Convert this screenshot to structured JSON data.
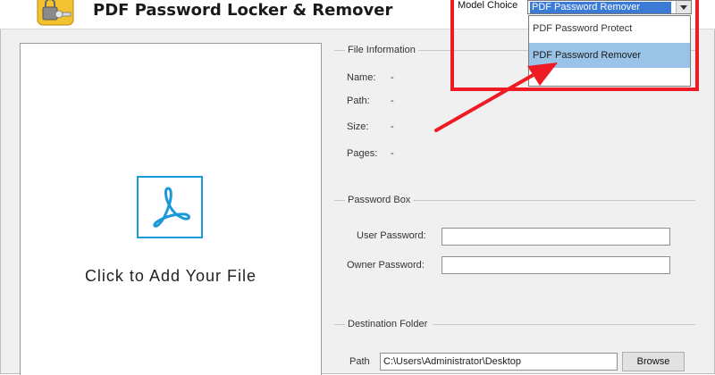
{
  "app": {
    "title": "PDF Password Locker & Remover",
    "logo": "lock-key-app-icon"
  },
  "model_choice": {
    "label": "Model Choice",
    "selected": "PDF Password Remover",
    "options": [
      "PDF Password Protect",
      "PDF Password Remover"
    ],
    "highlighted_option": "PDF Password Remover"
  },
  "drop_zone": {
    "text": "Click to Add Your File",
    "icon": "pdf-acrobat-icon",
    "icon_color": "#1b98d8"
  },
  "file_info": {
    "title": "File Information",
    "fields": [
      {
        "label": "Name:",
        "value": "-"
      },
      {
        "label": "Path:",
        "value": "-"
      },
      {
        "label": "Size:",
        "value": "-"
      },
      {
        "label": "Pages:",
        "value": "-"
      }
    ]
  },
  "password_box": {
    "title": "Password Box",
    "user_label": "User Password:",
    "user_value": "",
    "owner_label": "Owner Password:",
    "owner_value": ""
  },
  "destination": {
    "title": "Destination Folder",
    "path_label": "Path",
    "path_value": "C:\\Users\\Administrator\\Desktop",
    "browse_label": "Browse"
  },
  "colors": {
    "annotation_red": "#ee1b24",
    "selection_blue": "#3b7bd6",
    "hover_blue": "#99c4e8",
    "pdf_blue": "#1b98d8"
  }
}
